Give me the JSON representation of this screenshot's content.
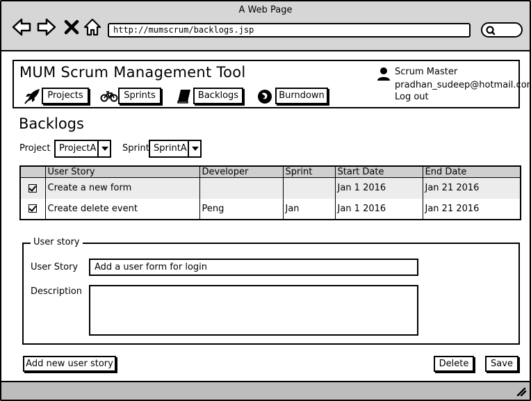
{
  "browser": {
    "window_title": "A Web Page",
    "url": "http://mumscrum/backlogs.jsp"
  },
  "header": {
    "app_title": "MUM Scrum Management Tool",
    "nav": [
      {
        "label": "Projects",
        "icon": "rocket-icon"
      },
      {
        "label": "Sprints",
        "icon": "bicycle-icon"
      },
      {
        "label": "Backlogs",
        "icon": "book-icon"
      },
      {
        "label": "Burndown",
        "icon": "firefox-icon"
      }
    ],
    "user": {
      "role": "Scrum Master",
      "email": "pradhan_sudeep@hotmail.com",
      "logout": "Log out"
    }
  },
  "page": {
    "title": "Backlogs",
    "filters": {
      "project_label": "Project",
      "project_value": "ProjectA",
      "sprint_label": "Sprint",
      "sprint_value": "SprintA"
    }
  },
  "table": {
    "columns": [
      "",
      "User Story",
      "Developer",
      "Sprint",
      "Start Date",
      "End Date"
    ],
    "rows": [
      {
        "checked": true,
        "story": "Create a new form",
        "developer": "",
        "sprint": "",
        "start": "Jan 1 2016",
        "end": "Jan 21 2016"
      },
      {
        "checked": true,
        "story": "Create delete event",
        "developer": "Peng",
        "sprint": "Jan",
        "start": "Jan 1 2016",
        "end": "Jan 21 2016"
      }
    ]
  },
  "form": {
    "legend": "User story",
    "story_label": "User Story",
    "story_value": "Add a user form for login",
    "description_label": "Description",
    "description_value": ""
  },
  "actions": {
    "add_label": "Add new user story",
    "delete_label": "Delete",
    "save_label": "Save"
  }
}
